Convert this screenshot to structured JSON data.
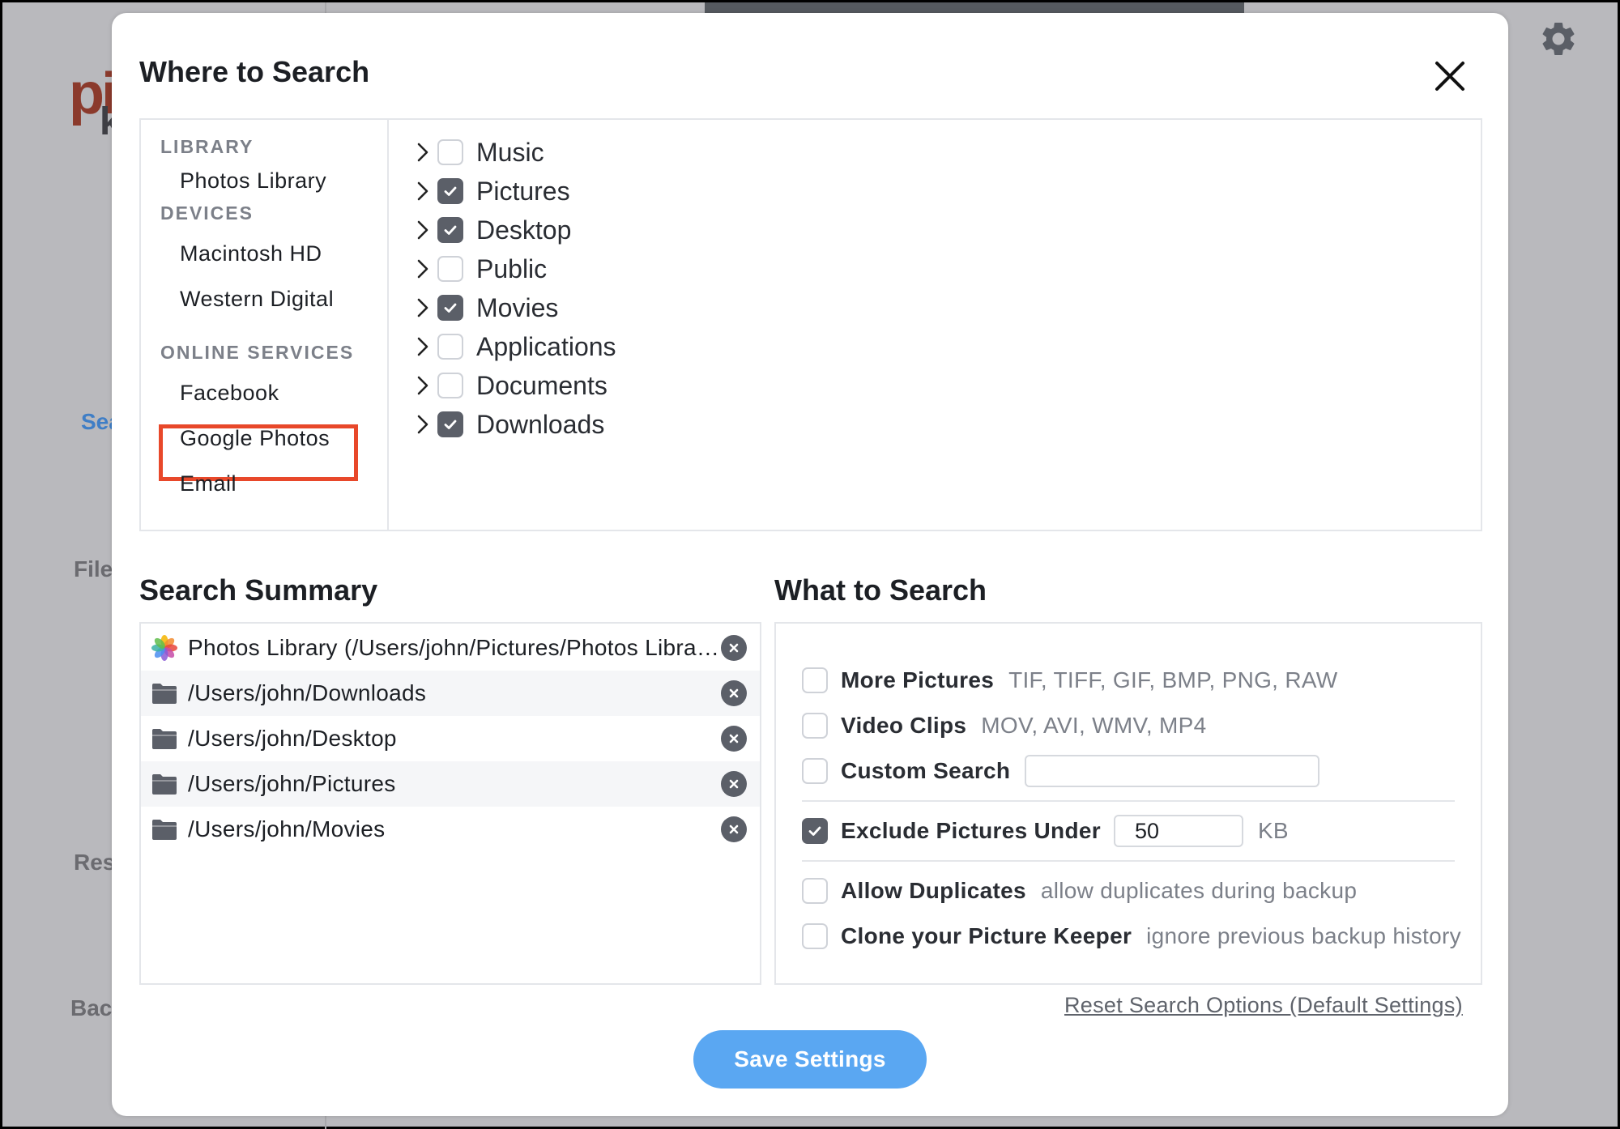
{
  "background": {
    "logo_top": "pi",
    "logo_bottom": "k",
    "nav": [
      {
        "label": "Sea",
        "active": true
      },
      {
        "label": "File",
        "active": false
      },
      {
        "label": "Res",
        "active": false
      },
      {
        "label": "Bacl",
        "active": false
      }
    ],
    "gear_icon": "gear-icon"
  },
  "dialog": {
    "title": "Where to Search",
    "close_icon": "close-icon"
  },
  "sources": {
    "library_heading": "LIBRARY",
    "library_items": [
      "Photos Library"
    ],
    "devices_heading": "DEVICES",
    "device_items": [
      "Macintosh HD",
      "Western Digital"
    ],
    "online_heading": "ONLINE SERVICES",
    "online_items": [
      "Facebook",
      "Google Photos",
      "Email"
    ],
    "highlighted": "Google Photos",
    "highlight_color": "#e8482a"
  },
  "folders": [
    {
      "label": "Music",
      "checked": false
    },
    {
      "label": "Pictures",
      "checked": true
    },
    {
      "label": "Desktop",
      "checked": true
    },
    {
      "label": "Public",
      "checked": false
    },
    {
      "label": "Movies",
      "checked": true
    },
    {
      "label": "Applications",
      "checked": false
    },
    {
      "label": "Documents",
      "checked": false
    },
    {
      "label": "Downloads",
      "checked": true
    }
  ],
  "summary": {
    "title": "Search Summary",
    "items": [
      {
        "icon": "photos-app-icon",
        "text": "Photos Library (/Users/john/Pictures/Photos Library.photoslibrary)"
      },
      {
        "icon": "folder-icon",
        "text": "/Users/john/Downloads"
      },
      {
        "icon": "folder-icon",
        "text": "/Users/john/Desktop"
      },
      {
        "icon": "folder-icon",
        "text": "/Users/john/Pictures"
      },
      {
        "icon": "folder-icon",
        "text": "/Users/john/Movies"
      }
    ]
  },
  "what": {
    "title": "What to Search",
    "more_pictures": {
      "label": "More Pictures",
      "hint": "TIF, TIFF, GIF, BMP, PNG, RAW",
      "checked": false
    },
    "video_clips": {
      "label": "Video Clips",
      "hint": "MOV, AVI, WMV, MP4",
      "checked": false
    },
    "custom_search": {
      "label": "Custom Search",
      "value": "",
      "checked": false
    },
    "exclude": {
      "label": "Exclude Pictures Under",
      "value": "50",
      "unit": "KB",
      "checked": true
    },
    "allow_duplicates": {
      "label": "Allow Duplicates",
      "hint": "allow duplicates during backup",
      "checked": false
    },
    "clone": {
      "label": "Clone your Picture Keeper",
      "hint": "ignore previous backup history",
      "checked": false
    }
  },
  "reset_link": "Reset Search Options (Default Settings)",
  "save_button": "Save Settings",
  "colors": {
    "accent": "#5aa7f2",
    "checkbox_checked": "#5b5f68",
    "highlight": "#e8482a"
  }
}
